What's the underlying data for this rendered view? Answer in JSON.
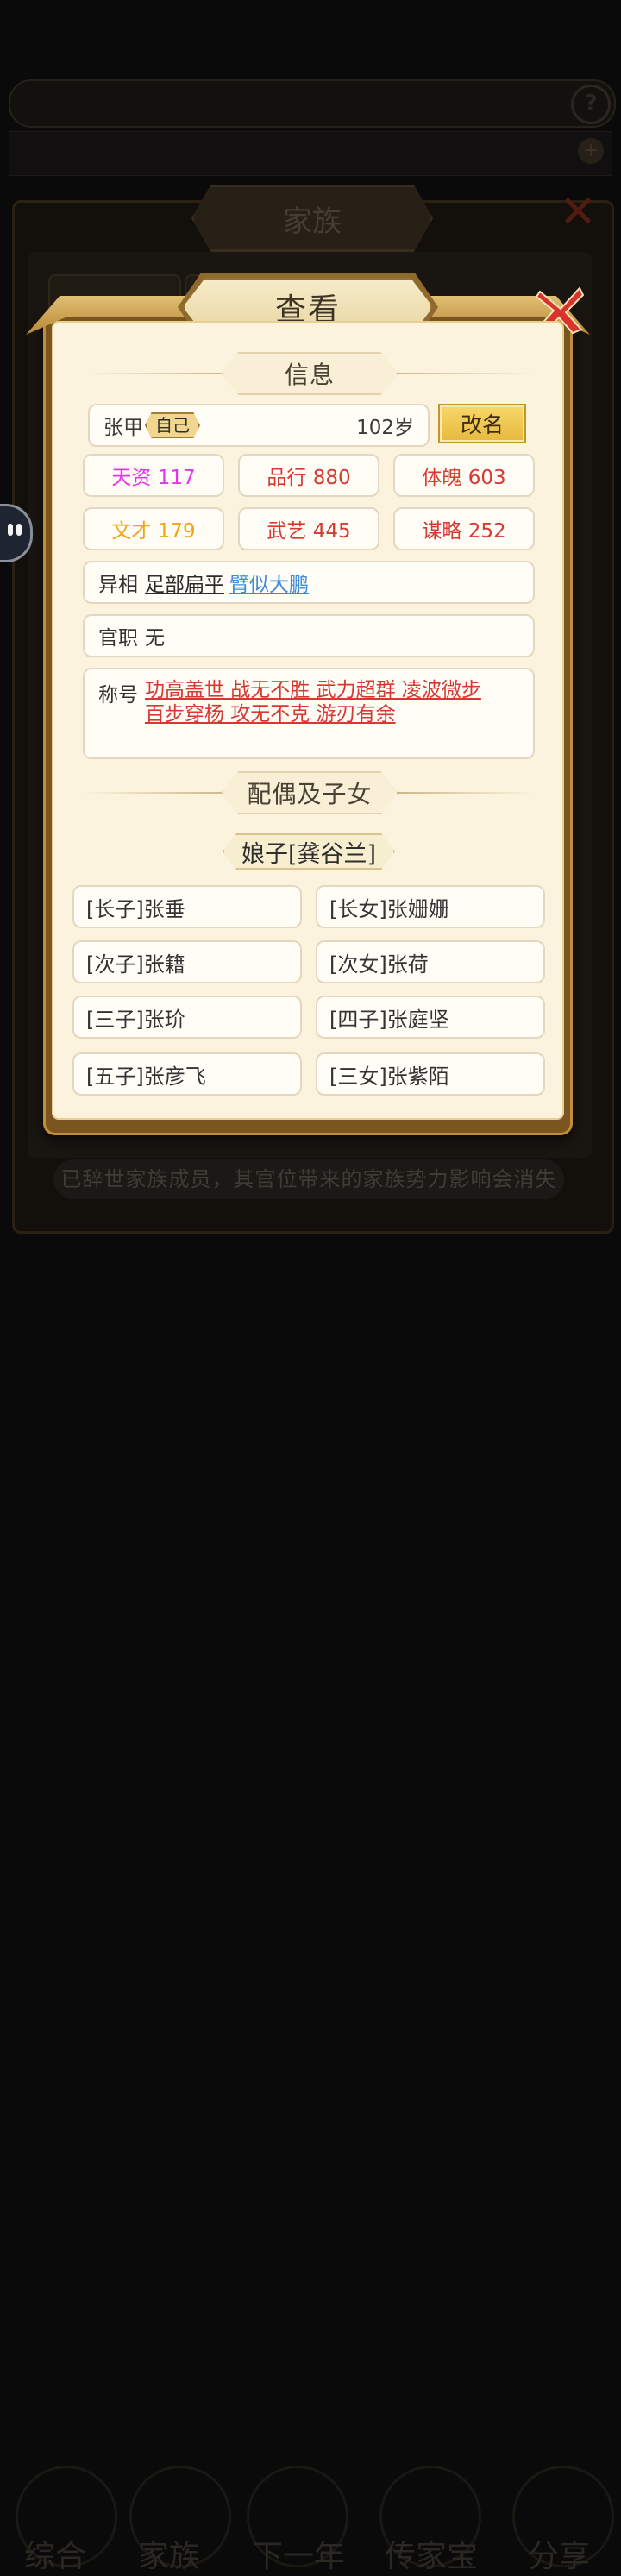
{
  "background": {
    "panel_title": "家族",
    "notice": "已辞世家族成员，其官位带来的家族势力影响会消失",
    "nav": [
      "综合",
      "家族",
      "下一年",
      "传家宝",
      "分享"
    ]
  },
  "modal": {
    "title": "查看",
    "info_header": "信息",
    "name": "张甲",
    "self_tag": "自己",
    "age": "102岁",
    "rename_label": "改名",
    "stats": [
      {
        "label": "天资 117",
        "color": "#e534e8"
      },
      {
        "label": "品行 880",
        "color": "#d43a33"
      },
      {
        "label": "体魄 603",
        "color": "#d43a33"
      },
      {
        "label": "文才 179",
        "color": "#f0a41c"
      },
      {
        "label": "武艺 445",
        "color": "#d43a33"
      },
      {
        "label": "谋略 252",
        "color": "#d43a33"
      }
    ],
    "yixiang": {
      "label": "异相",
      "value1": "足部扁平",
      "value2": "臂似大鹏"
    },
    "official": {
      "label": "官职",
      "value": "无"
    },
    "titles": {
      "label": "称号",
      "line1": "功高盖世 战无不胜 武力超群 凌波微步",
      "line2": "百步穿杨 攻无不克 游刃有余"
    },
    "family_header": "配偶及子女",
    "spouse": "娘子[龚谷兰]",
    "children": [
      "[长子]张垂",
      "[长女]张姗姗",
      "[次子]张籍",
      "[次女]张荷",
      "[三子]张玠",
      "[四子]张庭坚",
      "[五子]张彦飞",
      "[三女]张紫陌"
    ]
  }
}
